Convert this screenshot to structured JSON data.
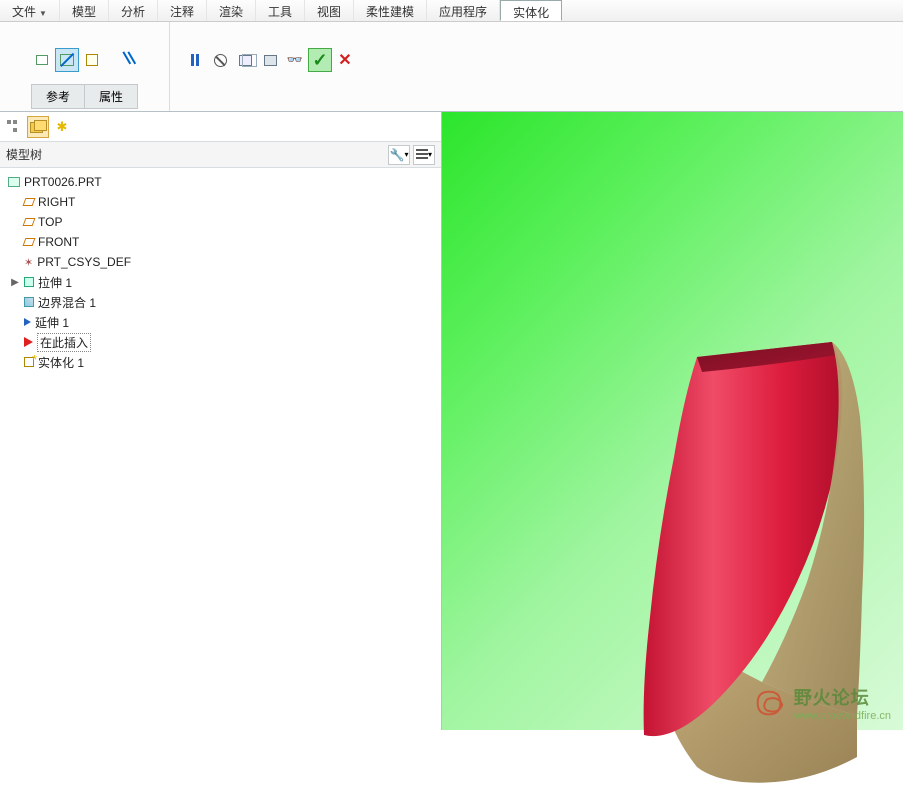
{
  "menu": {
    "items": [
      "文件",
      "模型",
      "分析",
      "注释",
      "渲染",
      "工具",
      "视图",
      "柔性建模",
      "应用程序",
      "实体化"
    ],
    "active_index": 9
  },
  "ribbon": {
    "tabs": [
      "参考",
      "属性"
    ]
  },
  "sidebar": {
    "header": "模型树",
    "root": "PRT0026.PRT",
    "items": [
      {
        "label": "RIGHT",
        "icon": "plane"
      },
      {
        "label": "TOP",
        "icon": "plane"
      },
      {
        "label": "FRONT",
        "icon": "plane"
      },
      {
        "label": "PRT_CSYS_DEF",
        "icon": "csys"
      },
      {
        "label": "拉伸 1",
        "icon": "extrude",
        "expandable": true
      },
      {
        "label": "边界混合 1",
        "icon": "blend"
      },
      {
        "label": "延伸 1",
        "icon": "extend"
      },
      {
        "label": "在此插入",
        "icon": "arrow",
        "boxed": true
      },
      {
        "label": "实体化 1",
        "icon": "solidify"
      }
    ]
  },
  "watermark": {
    "title": "野火论坛",
    "url": "www.proewildfire.cn"
  },
  "colors": {
    "viewport_top": "#2ce52c",
    "viewport_bottom": "#d8fad8",
    "shape_red": "#dd1c3d",
    "shape_red_light": "#ef4c68",
    "shape_tan": "#b39a6a"
  }
}
